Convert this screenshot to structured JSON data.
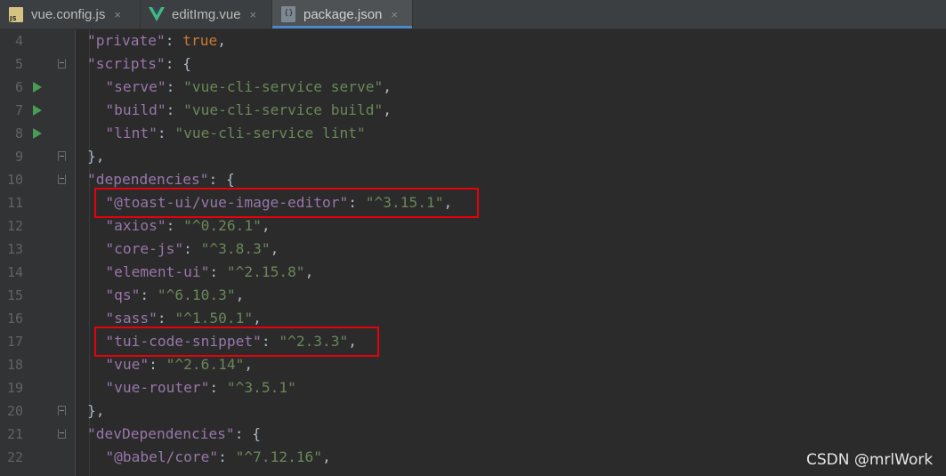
{
  "tabs": [
    {
      "label": "vue.config.js",
      "icon": "js-file-icon",
      "active": false
    },
    {
      "label": "editImg.vue",
      "icon": "vue-file-icon",
      "active": false
    },
    {
      "label": "package.json",
      "icon": "json-file-icon",
      "active": true
    }
  ],
  "close_glyph": "×",
  "js_badge": "JS",
  "json_badge": "{}",
  "lines": [
    {
      "num": "4",
      "indent": 1,
      "key": "\"private\"",
      "sep": ": ",
      "value": "true",
      "vtype": "keyword",
      "tail": ","
    },
    {
      "num": "5",
      "indent": 1,
      "key": "\"scripts\"",
      "sep": ": ",
      "value": "",
      "vtype": "",
      "tail": "{",
      "fold": "open"
    },
    {
      "num": "6",
      "indent": 2,
      "key": "\"serve\"",
      "sep": ": ",
      "value": "\"vue-cli-service serve\"",
      "vtype": "string",
      "tail": ",",
      "run": true
    },
    {
      "num": "7",
      "indent": 2,
      "key": "\"build\"",
      "sep": ": ",
      "value": "\"vue-cli-service build\"",
      "vtype": "string",
      "tail": ",",
      "run": true
    },
    {
      "num": "8",
      "indent": 2,
      "key": "\"lint\"",
      "sep": ": ",
      "value": "\"vue-cli-service lint\"",
      "vtype": "string",
      "tail": "",
      "run": true
    },
    {
      "num": "9",
      "indent": 1,
      "key": "",
      "sep": "",
      "value": "",
      "vtype": "",
      "tail": "},",
      "fold": "close"
    },
    {
      "num": "10",
      "indent": 1,
      "key": "\"dependencies\"",
      "sep": ": ",
      "value": "",
      "vtype": "",
      "tail": "{",
      "fold": "open"
    },
    {
      "num": "11",
      "indent": 2,
      "key": "\"@toast-ui/vue-image-editor\"",
      "sep": ": ",
      "value": "\"^3.15.1\"",
      "vtype": "string",
      "tail": ","
    },
    {
      "num": "12",
      "indent": 2,
      "key": "\"axios\"",
      "sep": ": ",
      "value": "\"^0.26.1\"",
      "vtype": "string",
      "tail": ","
    },
    {
      "num": "13",
      "indent": 2,
      "key": "\"core-js\"",
      "sep": ": ",
      "value": "\"^3.8.3\"",
      "vtype": "string",
      "tail": ","
    },
    {
      "num": "14",
      "indent": 2,
      "key": "\"element-ui\"",
      "sep": ": ",
      "value": "\"^2.15.8\"",
      "vtype": "string",
      "tail": ","
    },
    {
      "num": "15",
      "indent": 2,
      "key": "\"qs\"",
      "sep": ": ",
      "value": "\"^6.10.3\"",
      "vtype": "string",
      "tail": ","
    },
    {
      "num": "16",
      "indent": 2,
      "key": "\"sass\"",
      "sep": ": ",
      "value": "\"^1.50.1\"",
      "vtype": "string",
      "tail": ","
    },
    {
      "num": "17",
      "indent": 2,
      "key": "\"tui-code-snippet\"",
      "sep": ": ",
      "value": "\"^2.3.3\"",
      "vtype": "string",
      "tail": ","
    },
    {
      "num": "18",
      "indent": 2,
      "key": "\"vue\"",
      "sep": ": ",
      "value": "\"^2.6.14\"",
      "vtype": "string",
      "tail": ","
    },
    {
      "num": "19",
      "indent": 2,
      "key": "\"vue-router\"",
      "sep": ": ",
      "value": "\"^3.5.1\"",
      "vtype": "string",
      "tail": ""
    },
    {
      "num": "20",
      "indent": 1,
      "key": "",
      "sep": "",
      "value": "",
      "vtype": "",
      "tail": "},",
      "fold": "close"
    },
    {
      "num": "21",
      "indent": 1,
      "key": "\"devDependencies\"",
      "sep": ": ",
      "value": "",
      "vtype": "",
      "tail": "{",
      "fold": "open"
    },
    {
      "num": "22",
      "indent": 2,
      "key": "\"@babel/core\"",
      "sep": ": ",
      "value": "\"^7.12.16\"",
      "vtype": "string",
      "tail": ","
    }
  ],
  "highlighted_lines": [
    "11",
    "17"
  ],
  "highlight_color": "#e8000a",
  "colors": {
    "key": "#9876aa",
    "string": "#6a8759",
    "keyword": "#cc7832",
    "punct": "#a9b7c6",
    "line_number": "#606366",
    "run_marker": "#499c54",
    "tab_accent": "#4a88c7"
  },
  "watermark": "CSDN @mrlWork"
}
